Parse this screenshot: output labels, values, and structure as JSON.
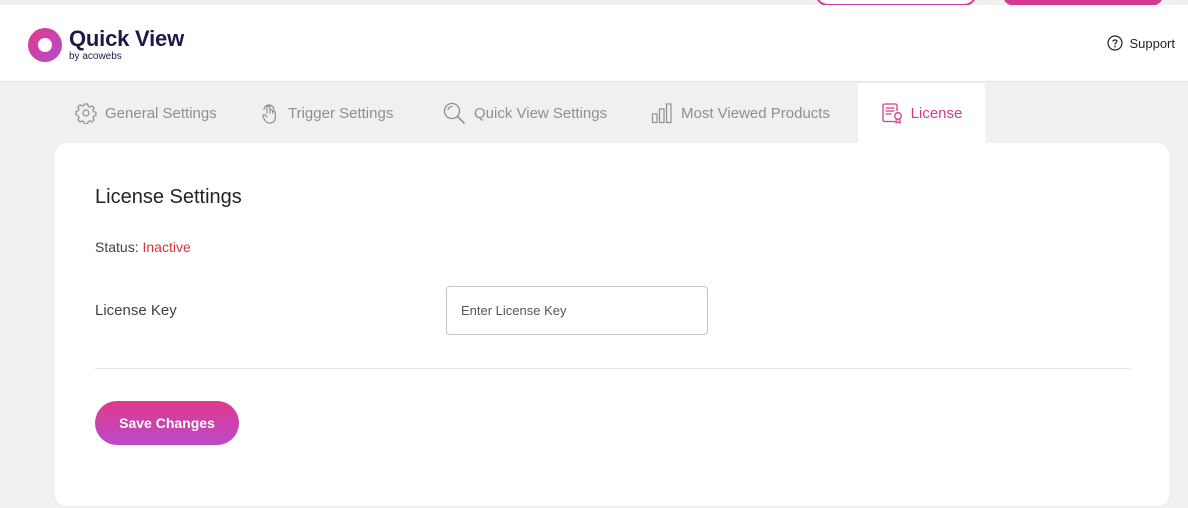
{
  "header": {
    "brand_title": "Quick View",
    "brand_subtitle": "by acowebs",
    "support_label": "Support"
  },
  "tabs": [
    {
      "label": "General Settings",
      "icon": "gear-icon"
    },
    {
      "label": "Trigger Settings",
      "icon": "touch-icon"
    },
    {
      "label": "Quick View Settings",
      "icon": "magnifier-icon"
    },
    {
      "label": "Most Viewed Products",
      "icon": "bar-chart-icon"
    },
    {
      "label": "License",
      "icon": "certificate-icon",
      "active": true
    }
  ],
  "license": {
    "title": "License Settings",
    "status_label": "Status:",
    "status_value": "Inactive",
    "key_label": "License Key",
    "key_placeholder": "Enter License Key",
    "key_value": "",
    "save_label": "Save Changes"
  },
  "colors": {
    "accent": "#d63a8e",
    "accent_gradient_end": "#b94ac9",
    "status_inactive": "#d63638",
    "brand_navy": "#1c1a4a"
  }
}
